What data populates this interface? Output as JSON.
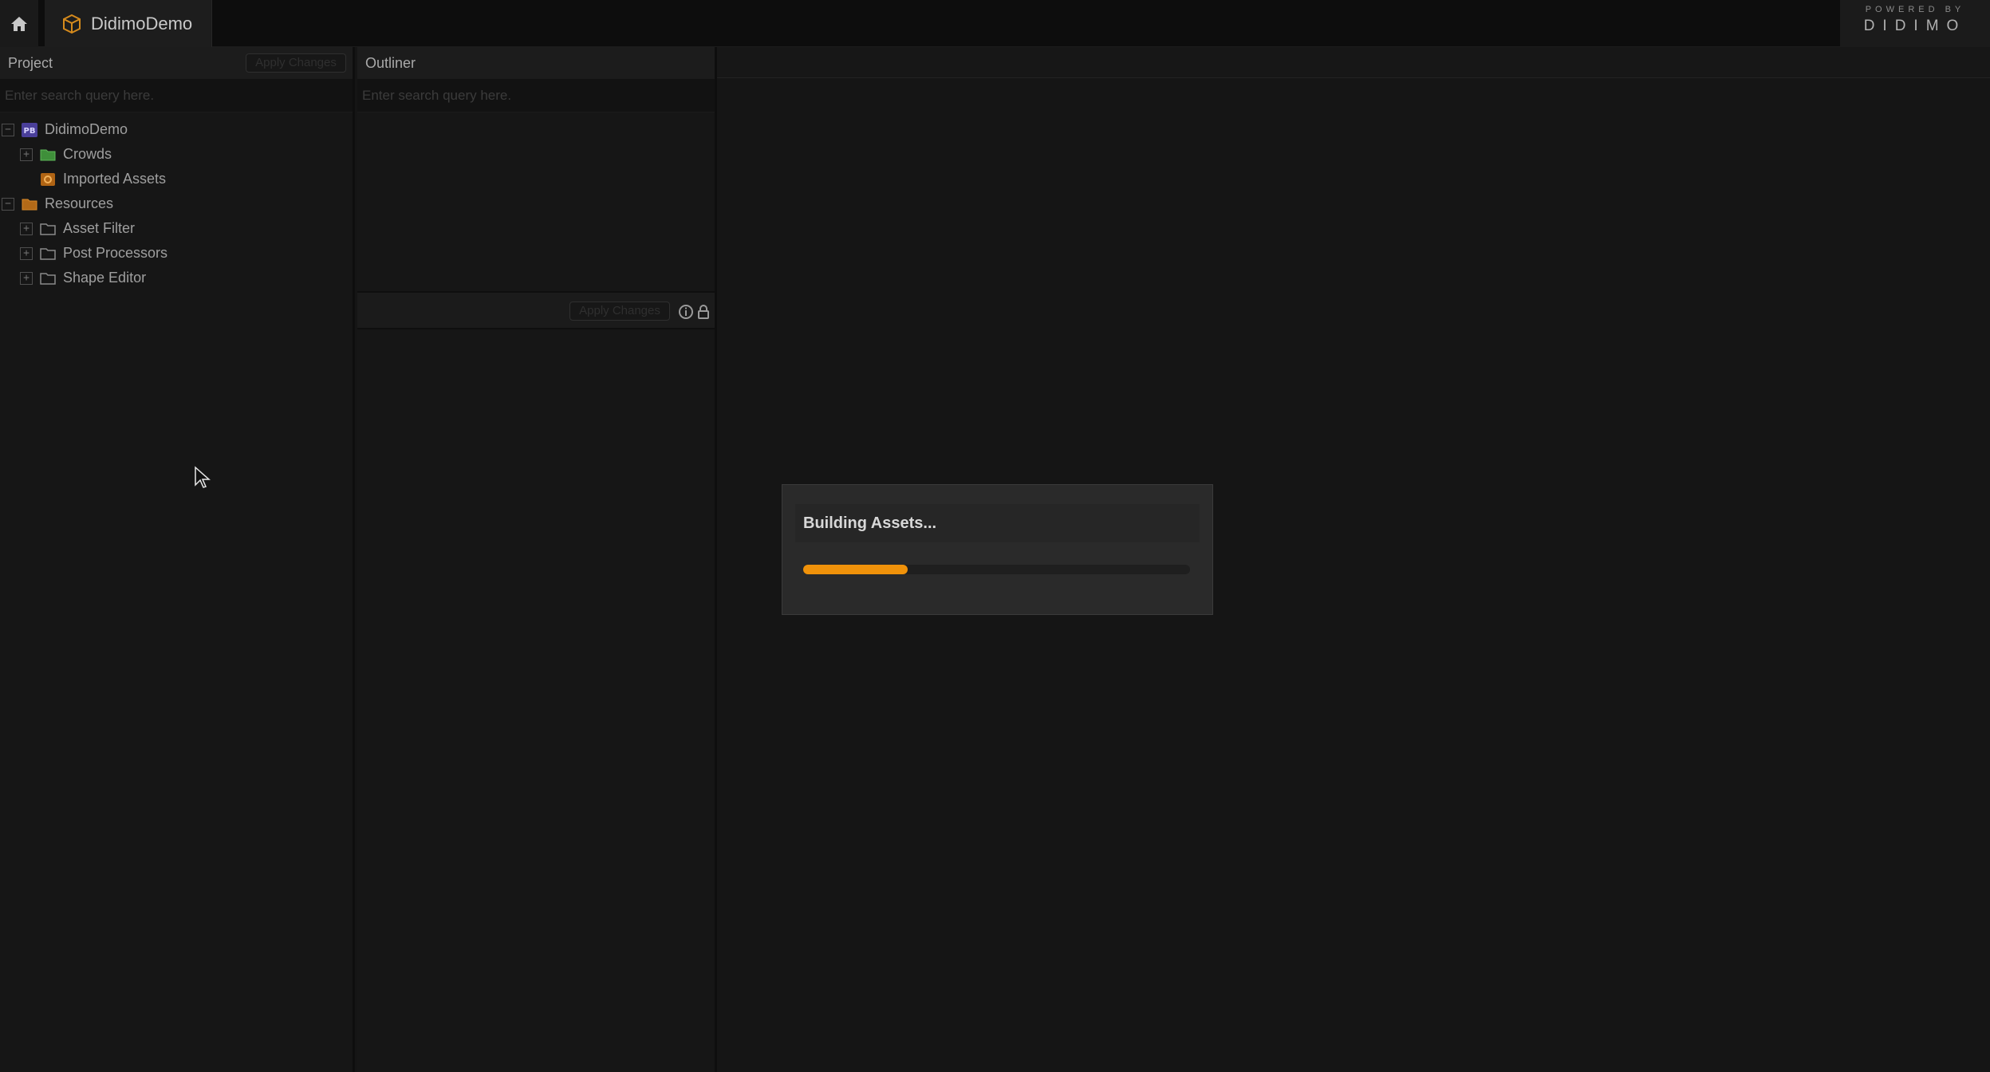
{
  "topbar": {
    "home_icon": "home-icon",
    "project_tab": {
      "label": "DidimoDemo",
      "icon": "package-icon"
    },
    "brand": {
      "tagline": "POWERED BY",
      "name": "DIDIMO"
    }
  },
  "project_panel": {
    "title": "Project",
    "apply_label": "Apply Changes",
    "search_placeholder": "Enter search query here.",
    "tree": [
      {
        "label": "DidimoDemo",
        "expander": "−",
        "icon": "project-badge-icon",
        "level": 0
      },
      {
        "label": "Crowds",
        "expander": "+",
        "icon": "green-folder-icon",
        "level": 1
      },
      {
        "label": "Imported Assets",
        "expander": "",
        "icon": "orange-package-icon",
        "level": 1
      },
      {
        "label": "Resources",
        "expander": "−",
        "icon": "orange-folder-icon",
        "level": 0
      },
      {
        "label": "Asset Filter",
        "expander": "+",
        "icon": "folder-icon",
        "level": 1
      },
      {
        "label": "Post Processors",
        "expander": "+",
        "icon": "folder-icon",
        "level": 1
      },
      {
        "label": "Shape Editor",
        "expander": "+",
        "icon": "folder-icon",
        "level": 1
      }
    ]
  },
  "outliner_panel": {
    "title": "Outliner",
    "search_placeholder": "Enter search query here.",
    "apply_label": "Apply Changes",
    "icons": [
      "info-icon",
      "lock-icon"
    ]
  },
  "modal": {
    "title": "Building Assets...",
    "progress_fraction": 0.27,
    "accent": "#f0920a"
  }
}
